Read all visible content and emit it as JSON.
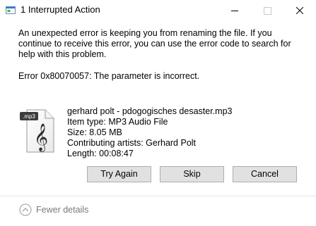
{
  "window": {
    "title": "1 Interrupted Action",
    "app_icon": "file-move-icon",
    "controls": {
      "minimize_icon": "minimize-icon",
      "maximize_icon": "maximize-icon",
      "close_icon": "close-icon"
    }
  },
  "message": {
    "text": "An unexpected error is keeping you from renaming the file. If you continue to receive this error, you can use the error code to search for help with this problem.",
    "error": "Error 0x80070057: The parameter is incorrect."
  },
  "file": {
    "icon": "mp3-file-icon",
    "icon_badge": ".mp3",
    "name": "gerhard polt - pdogogisches desaster.mp3",
    "item_type": "Item type: MP3 Audio File",
    "size": "Size: 8.05 MB",
    "artists": "Contributing artists: Gerhard Polt",
    "length": "Length: 00:08:47"
  },
  "buttons": {
    "try_again": "Try Again",
    "skip": "Skip",
    "cancel": "Cancel"
  },
  "footer": {
    "fewer_details": "Fewer details",
    "icon": "chevron-up-circle-icon"
  },
  "colors": {
    "button_bg": "#e1e1e1",
    "button_border": "#adadad",
    "footer_text": "#7a7a7a"
  }
}
